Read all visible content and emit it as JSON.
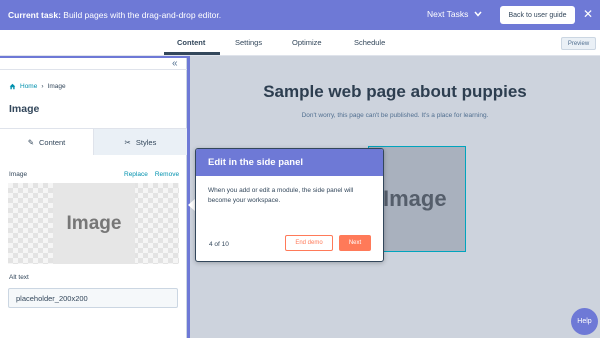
{
  "topbar": {
    "task_prefix": "Current task:",
    "task_text": "Build pages with the drag-and-drop editor.",
    "next_tasks": "Next Tasks",
    "back_button": "Back to user guide",
    "close_glyph": "✕",
    "background": "#6e79d6"
  },
  "tabs": [
    {
      "label": "Content",
      "active": true
    },
    {
      "label": "Settings",
      "active": false
    },
    {
      "label": "Optimize",
      "active": false
    },
    {
      "label": "Schedule",
      "active": false
    }
  ],
  "preview_button": "Preview",
  "sidebar": {
    "collapse_glyph": "«",
    "breadcrumb": {
      "home": "Home",
      "separator": "›",
      "current": "Image"
    },
    "title": "Image",
    "tabs": [
      {
        "label": "Content",
        "icon": "pencil-icon",
        "glyph": "✎",
        "active": true
      },
      {
        "label": "Styles",
        "icon": "tools-icon",
        "glyph": "✂",
        "active": false
      }
    ],
    "image_label": "Image",
    "replace_link": "Replace",
    "remove_link": "Remove",
    "thumbnail_text": "Image",
    "alt_label": "Alt text",
    "alt_value": "placeholder_200x200"
  },
  "canvas": {
    "title": "Sample web page about puppies",
    "subtitle": "Don't worry, this page can't be published. It's a place for learning.",
    "image_text": "Image"
  },
  "tour": {
    "heading": "Edit in the side panel",
    "body": "When you add or edit a module, the side panel will become your workspace.",
    "count": "4 of 10",
    "end_demo": "End demo",
    "next": "Next",
    "accent": "#ff7a59"
  },
  "help_button": "Help"
}
